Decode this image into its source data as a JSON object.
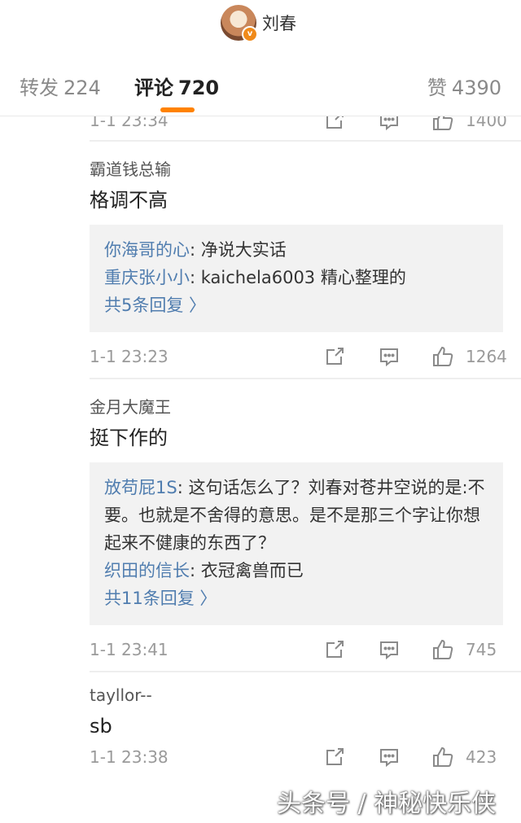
{
  "header": {
    "name": "刘春"
  },
  "tabs": [
    {
      "label": "转发",
      "count": "224"
    },
    {
      "label": "评论",
      "count": "720"
    },
    {
      "label": "赞",
      "count": "4390"
    }
  ],
  "previous_comment": {
    "time": "1-1 23:34",
    "likes": "1400"
  },
  "comments": [
    {
      "username": "霸道钱总输",
      "text": "格调不高",
      "replies": [
        {
          "user": "你海哥的心",
          "text": ": 净说大实话"
        },
        {
          "user": "重庆张小小",
          "text": ": kaichela6003 精心整理的"
        }
      ],
      "more": "共5条回复 〉",
      "time": "1-1 23:23",
      "likes": "1264"
    },
    {
      "username": "金月大魔王",
      "text": "挺下作的",
      "replies": [
        {
          "user": "放苟屁1S",
          "text": ": 这句话怎么了？刘春对苍井空说的是:不要。也就是不舍得的意思。是不是那三个字让你想起来不健康的东西了？"
        },
        {
          "user": "织田的信长",
          "text": ": 衣冠禽兽而已"
        }
      ],
      "more": "共11条回复 〉",
      "time": "1-1 23:41",
      "likes": "745"
    },
    {
      "username": "tayllor--",
      "text": "sb",
      "time": "1-1 23:38",
      "likes": "423"
    }
  ],
  "watermark": "头条号 / 神秘快乐侠",
  "colors": {
    "accent": "#ff8200",
    "link": "#507daf",
    "muted": "#9a9a9a"
  }
}
